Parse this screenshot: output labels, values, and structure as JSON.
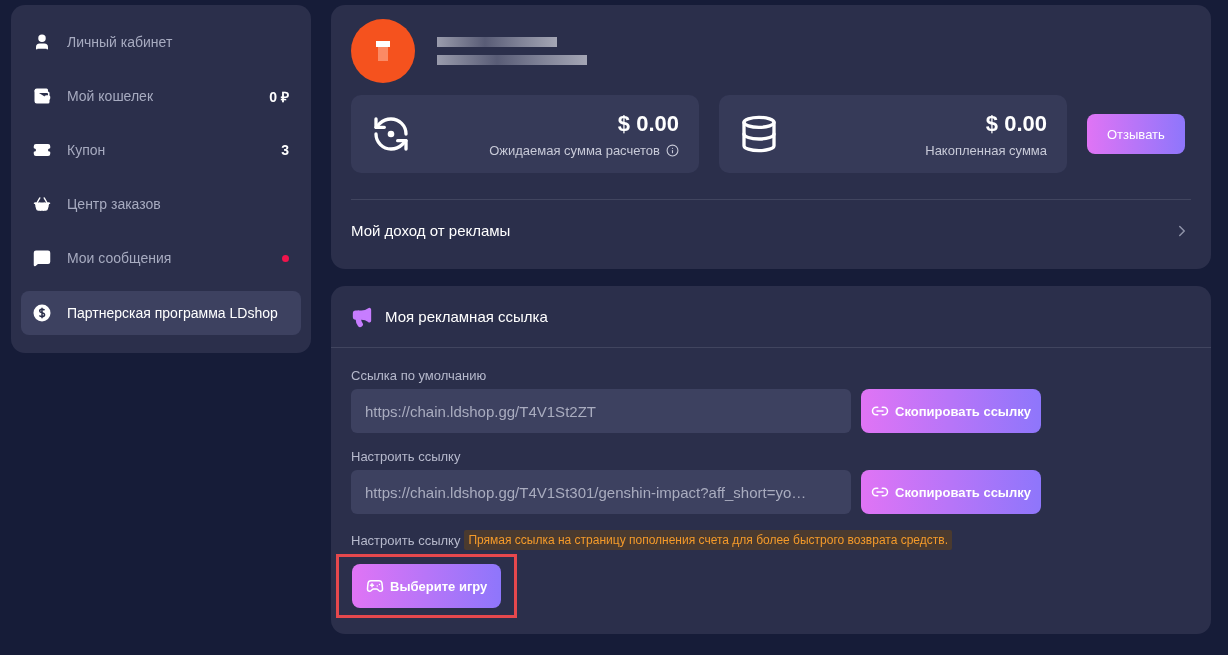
{
  "sidebar": {
    "items": [
      {
        "kind": "user",
        "label": "Личный кабинет",
        "selected": false
      },
      {
        "kind": "wallet",
        "label": "Мой кошелек",
        "badge": "0 ₽",
        "selected": false
      },
      {
        "kind": "coupon",
        "label": "Купон",
        "badge": "3",
        "selected": false
      },
      {
        "kind": "basket",
        "label": "Центр заказов",
        "selected": false
      },
      {
        "kind": "chat",
        "label": "Мои сообщения",
        "unread": true,
        "selected": false
      },
      {
        "kind": "coin",
        "label": "Партнерская программа LDshop",
        "selected": true
      }
    ]
  },
  "profile": {
    "stats": [
      {
        "kind": "refund",
        "amount": "$ 0.00",
        "label": "Ожидаемая сумма расчетов",
        "info": true
      },
      {
        "kind": "coins",
        "amount": "$ 0.00",
        "label": "Накопленная сумма",
        "info": false
      }
    ],
    "withdraw_button": "Отзывать",
    "income_link": "Мой доход от рекламы"
  },
  "ad_link": {
    "title": "Моя рекламная ссылка",
    "fields": [
      {
        "label": "Ссылка по умолчанию",
        "value": "https://chain.ldshop.gg/T4V1St2ZT",
        "button": "Скопировать ссылку"
      },
      {
        "label": "Настроить ссылку",
        "value": "https://chain.ldshop.gg/T4V1St301/genshin-impact?aff_short=yo…",
        "button": "Скопировать ссылку"
      }
    ],
    "custom_label": "Настроить ссылку",
    "hint": "Прямая ссылка на страницу пополнения счета для более быстрого возврата средств.",
    "game_button": "Выберите игру",
    "game_button_highlighted": true
  }
}
